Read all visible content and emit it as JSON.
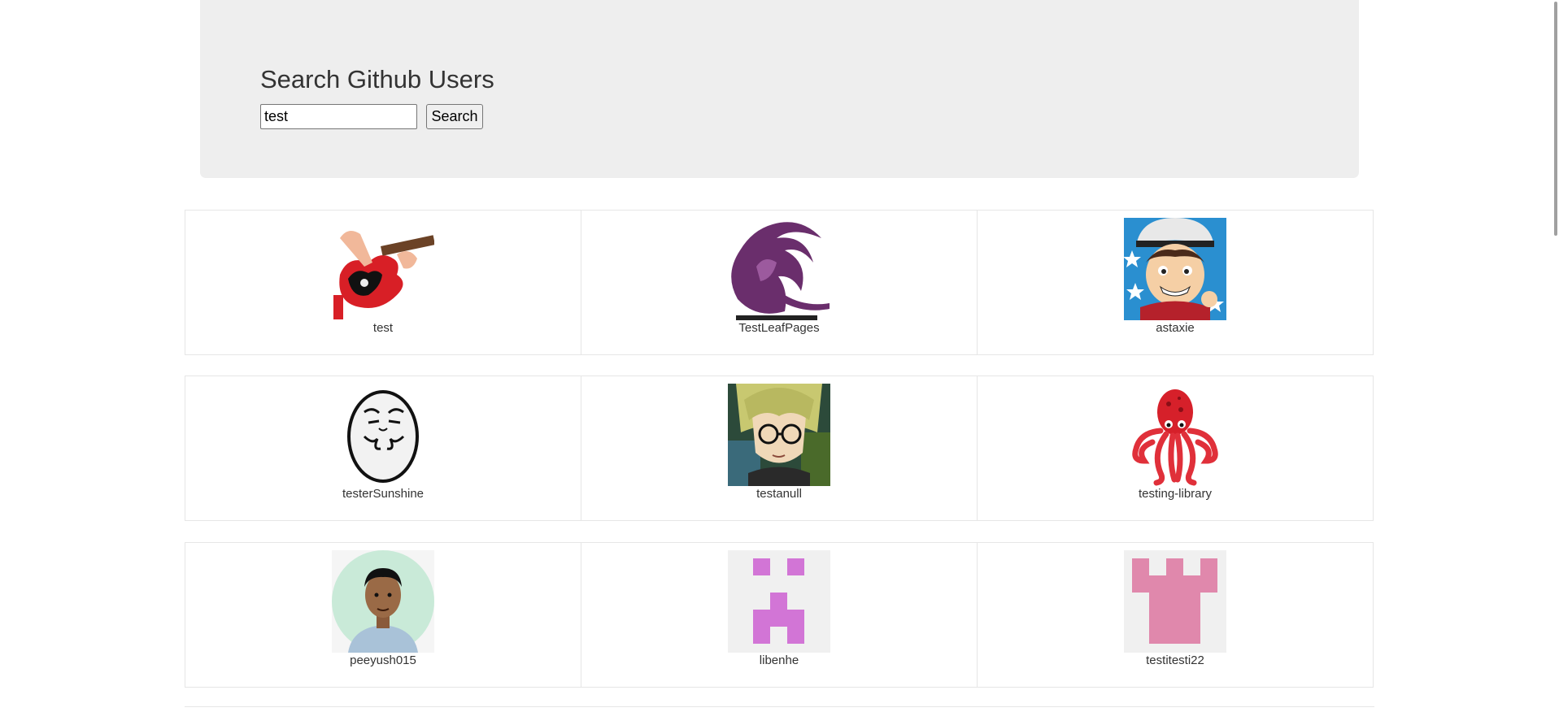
{
  "header": {
    "title": "Search Github Users",
    "search_value": "test",
    "search_button_label": "Search"
  },
  "results": [
    {
      "login": "test",
      "avatar_icon": "guitar-player-avatar"
    },
    {
      "login": "TestLeafPages",
      "avatar_icon": "purple-bird-logo-avatar"
    },
    {
      "login": "astaxie",
      "avatar_icon": "cartoon-man-hat-avatar"
    },
    {
      "login": "testerSunshine",
      "avatar_icon": "rage-face-avatar"
    },
    {
      "login": "testanull",
      "avatar_icon": "anime-glasses-avatar"
    },
    {
      "login": "testing-library",
      "avatar_icon": "red-octopus-avatar"
    },
    {
      "login": "peeyush015",
      "avatar_icon": "person-photo-avatar"
    },
    {
      "login": "libenhe",
      "avatar_icon": "identicon-avatar"
    },
    {
      "login": "testitesti22",
      "avatar_icon": "identicon-avatar"
    }
  ],
  "colors": {
    "header_bg": "#eeeeee",
    "card_border": "#e6e6e6",
    "identicon_purple": "#d275d6",
    "identicon_pink": "#e088ac",
    "identicon_bg": "#f0f0f0"
  }
}
